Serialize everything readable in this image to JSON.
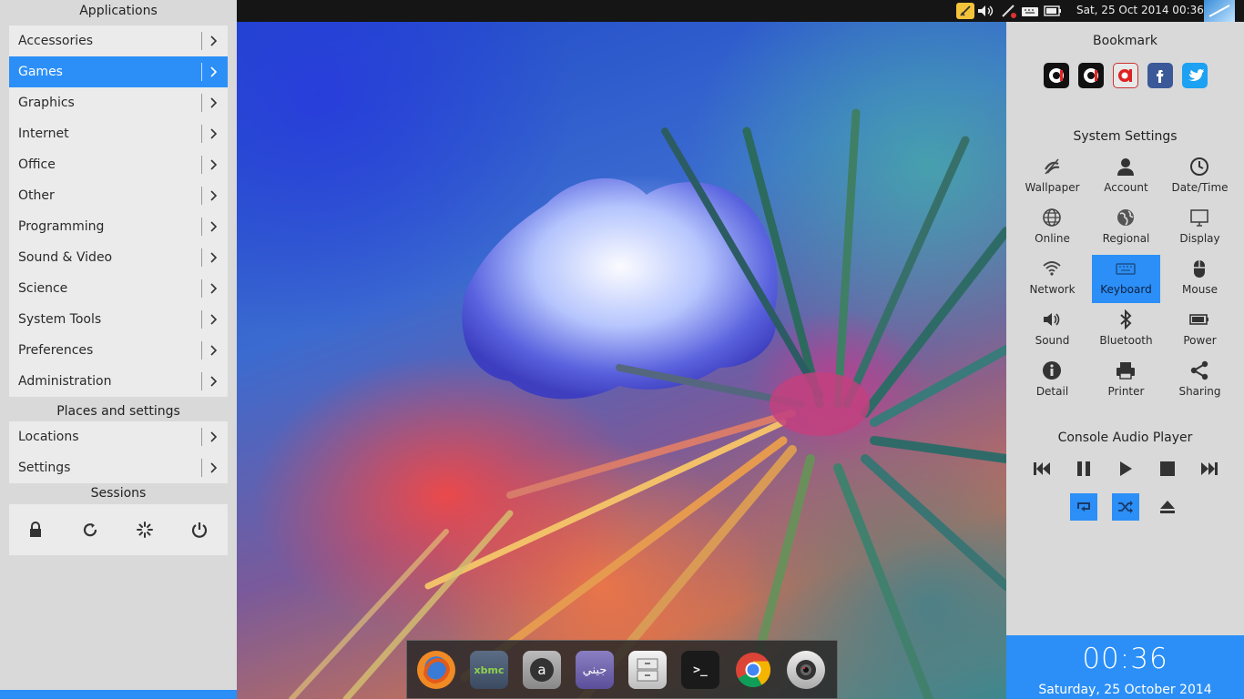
{
  "left_menu": {
    "applications_title": "Applications",
    "categories": [
      {
        "label": "Accessories"
      },
      {
        "label": "Games",
        "active": true
      },
      {
        "label": "Graphics"
      },
      {
        "label": "Internet"
      },
      {
        "label": "Office"
      },
      {
        "label": "Other"
      },
      {
        "label": "Programming"
      },
      {
        "label": "Sound & Video"
      },
      {
        "label": "Science"
      },
      {
        "label": "System Tools"
      },
      {
        "label": "Preferences"
      },
      {
        "label": "Administration"
      }
    ],
    "places_title": "Places and settings",
    "places": [
      {
        "label": "Locations"
      },
      {
        "label": "Settings"
      }
    ],
    "sessions_title": "Sessions",
    "session_buttons": [
      "lock-icon",
      "refresh-icon",
      "suspend-icon",
      "power-icon"
    ]
  },
  "topbar": {
    "datetime": "Sat, 25 Oct 2014 00:36",
    "tray_icons": [
      "note-icon",
      "volume-icon",
      "network-icon",
      "keyboard-icon",
      "battery-icon",
      "avatar-icon"
    ]
  },
  "right_panel": {
    "bookmark_title": "Bookmark",
    "bookmarks": [
      "bookmark-o-icon",
      "bookmark-o-icon",
      "bookmark-o-red-icon",
      "facebook-icon",
      "twitter-icon"
    ],
    "settings_title": "System Settings",
    "settings": [
      {
        "label": "Wallpaper",
        "icon": "wallpaper-icon"
      },
      {
        "label": "Account",
        "icon": "account-icon"
      },
      {
        "label": "Date/Time",
        "icon": "clock-icon"
      },
      {
        "label": "Online",
        "icon": "globe-icon"
      },
      {
        "label": "Regional",
        "icon": "earth-icon"
      },
      {
        "label": "Display",
        "icon": "monitor-icon"
      },
      {
        "label": "Network",
        "icon": "wifi-icon"
      },
      {
        "label": "Keyboard",
        "icon": "keyboard-icon",
        "active": true
      },
      {
        "label": "Mouse",
        "icon": "mouse-icon"
      },
      {
        "label": "Sound",
        "icon": "speaker-icon"
      },
      {
        "label": "Bluetooth",
        "icon": "bluetooth-icon"
      },
      {
        "label": "Power",
        "icon": "battery-icon"
      },
      {
        "label": "Detail",
        "icon": "info-icon"
      },
      {
        "label": "Printer",
        "icon": "printer-icon"
      },
      {
        "label": "Sharing",
        "icon": "share-icon"
      }
    ],
    "player_title": "Console Audio Player",
    "player_buttons": [
      "previous-icon",
      "pause-icon",
      "play-icon",
      "stop-icon",
      "next-icon"
    ],
    "player_toggles": [
      {
        "icon": "repeat-icon",
        "on": true
      },
      {
        "icon": "shuffle-icon",
        "on": true
      },
      {
        "icon": "eject-icon",
        "on": false
      }
    ],
    "time": "00:36",
    "date_long": "Saturday, 25 October 2014"
  },
  "dock": {
    "apps": [
      {
        "name": "firefox-icon"
      },
      {
        "name": "xbmc-icon",
        "label": "xbmc"
      },
      {
        "name": "amarok-icon",
        "label": "a"
      },
      {
        "name": "jini-icon",
        "label": "جيني"
      },
      {
        "name": "file-manager-icon"
      },
      {
        "name": "terminal-icon",
        "label": ">_"
      },
      {
        "name": "chrome-icon"
      },
      {
        "name": "camera-icon"
      }
    ]
  },
  "colors": {
    "accent": "#2b8ff7",
    "panel_bg": "#d9d9d9",
    "menu_bg": "#ebebeb",
    "topbar_bg": "#151515"
  }
}
